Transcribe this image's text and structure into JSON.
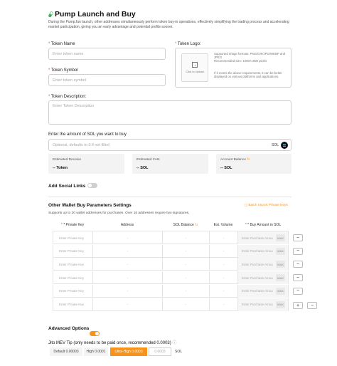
{
  "header": {
    "title": "Pump Launch and Buy",
    "description": "During the Pump.fun launch, other addresses simultaneously perform token buy-in operations, effectively simplifying the trading process and accelerating market participation, giving you an early advantage and potential profits sooner."
  },
  "form": {
    "token_name_label": "Token Name",
    "token_name_placeholder": "Enter token name",
    "token_symbol_label": "Token Symbol",
    "token_symbol_placeholder": "Enter token symbol",
    "token_logo_label": "Token Logo:",
    "upload_label": "Click to Upload",
    "logo_hint_1": "Supported image formats: PNG/GIF/JPG/WEBP and JPEG",
    "logo_hint_2": "Recommended size: 1000×1000 pixels",
    "logo_hint_3": "If it meets the above requirements, it can be better displayed on various platforms and applications.",
    "token_description_label": "Token Description:",
    "token_description_placeholder": "Enter Token Description",
    "sol_amount_label": "Enter the amount of SOL you want to buy",
    "sol_amount_placeholder": "Optional, defaults to 0 if not filled",
    "sol_unit": "SOL"
  },
  "stats": [
    {
      "label": "Estimated Receive",
      "value": "-- Token"
    },
    {
      "label": "Estimated Cost",
      "value": "-- SOL"
    },
    {
      "label": "Account Balance",
      "value": "-- SOL"
    }
  ],
  "social_links_label": "Add Social Links",
  "wallet_section": {
    "title": "Other Wallet Buy Parameters Settings",
    "import_link": "Batch Import Private Keys",
    "subtitle": "Supports up to 20 wallet addresses for purchases. Over 16 addresses require two signatures.",
    "columns": [
      "* Private Key",
      "Address",
      "SOL Balance",
      "Est. Volume",
      "* Buy Amount in SOL"
    ],
    "rows": [
      {
        "key_placeholder": "Enter Private Key",
        "address": "-",
        "balance": "-",
        "volume": "-",
        "amount_placeholder": "Enter Purchase Amou",
        "max": "MAX"
      },
      {
        "key_placeholder": "Enter Private Key",
        "address": "-",
        "balance": "-",
        "volume": "-",
        "amount_placeholder": "Enter Purchase Amou",
        "max": "MAX"
      },
      {
        "key_placeholder": "Enter Private Key",
        "address": "-",
        "balance": "-",
        "volume": "-",
        "amount_placeholder": "Enter Purchase Amou",
        "max": "MAX"
      },
      {
        "key_placeholder": "Enter Private Key",
        "address": "-",
        "balance": "-",
        "volume": "-",
        "amount_placeholder": "Enter Purchase Amou",
        "max": "MAX"
      },
      {
        "key_placeholder": "Enter Private Key",
        "address": "-",
        "balance": "-",
        "volume": "-",
        "amount_placeholder": "Enter Purchase Amou",
        "max": "MAX"
      },
      {
        "key_placeholder": "Enter Private Key",
        "address": "-",
        "balance": "-",
        "volume": "-",
        "amount_placeholder": "Enter Purchase Amou",
        "max": "MAX"
      }
    ],
    "remove_symbol": "−",
    "add_symbol": "+"
  },
  "advanced_options_label": "Advanced Options",
  "jito": {
    "label": "Jito MEV Tip (only needs to be paid once, recommended 0.0003)",
    "options": [
      "Default 0.00003",
      "High 0.0001",
      "Ultra-High 0.0003"
    ],
    "custom_placeholder": "0.0003",
    "unit": "SOL"
  },
  "colors": {
    "accent": "#f7931a",
    "border": "#cfcfcf",
    "stat_bg": "#f3f3f3"
  }
}
